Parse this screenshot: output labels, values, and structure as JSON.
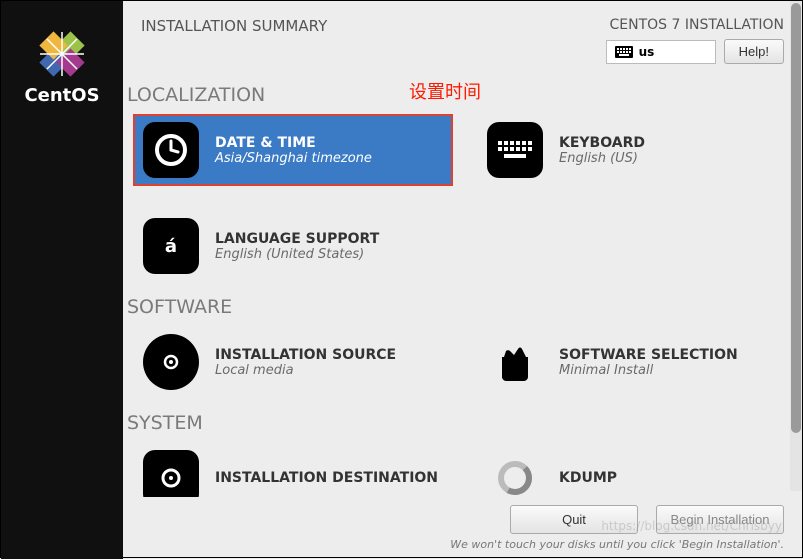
{
  "brand": "CentOS",
  "header": {
    "page_title": "INSTALLATION SUMMARY",
    "installer_title": "CENTOS 7 INSTALLATION",
    "keyboard_layout": "us",
    "help_label": "Help!"
  },
  "annotation": "设置时间",
  "sections": {
    "localization": {
      "label": "LOCALIZATION",
      "items": [
        {
          "title": "DATE & TIME",
          "subtitle": "Asia/Shanghai timezone"
        },
        {
          "title": "KEYBOARD",
          "subtitle": "English (US)"
        },
        {
          "title": "LANGUAGE SUPPORT",
          "subtitle": "English (United States)"
        }
      ]
    },
    "software": {
      "label": "SOFTWARE",
      "items": [
        {
          "title": "INSTALLATION SOURCE",
          "subtitle": "Local media"
        },
        {
          "title": "SOFTWARE SELECTION",
          "subtitle": "Minimal Install"
        }
      ]
    },
    "system": {
      "label": "SYSTEM",
      "items": [
        {
          "title": "INSTALLATION DESTINATION",
          "subtitle": ""
        },
        {
          "title": "KDUMP",
          "subtitle": ""
        }
      ]
    }
  },
  "footer": {
    "quit_label": "Quit",
    "begin_label": "Begin Installation",
    "hint": "We won't touch your disks until you click 'Begin Installation'."
  },
  "watermark": "https://blog.csdn.net/Chrisbyy"
}
